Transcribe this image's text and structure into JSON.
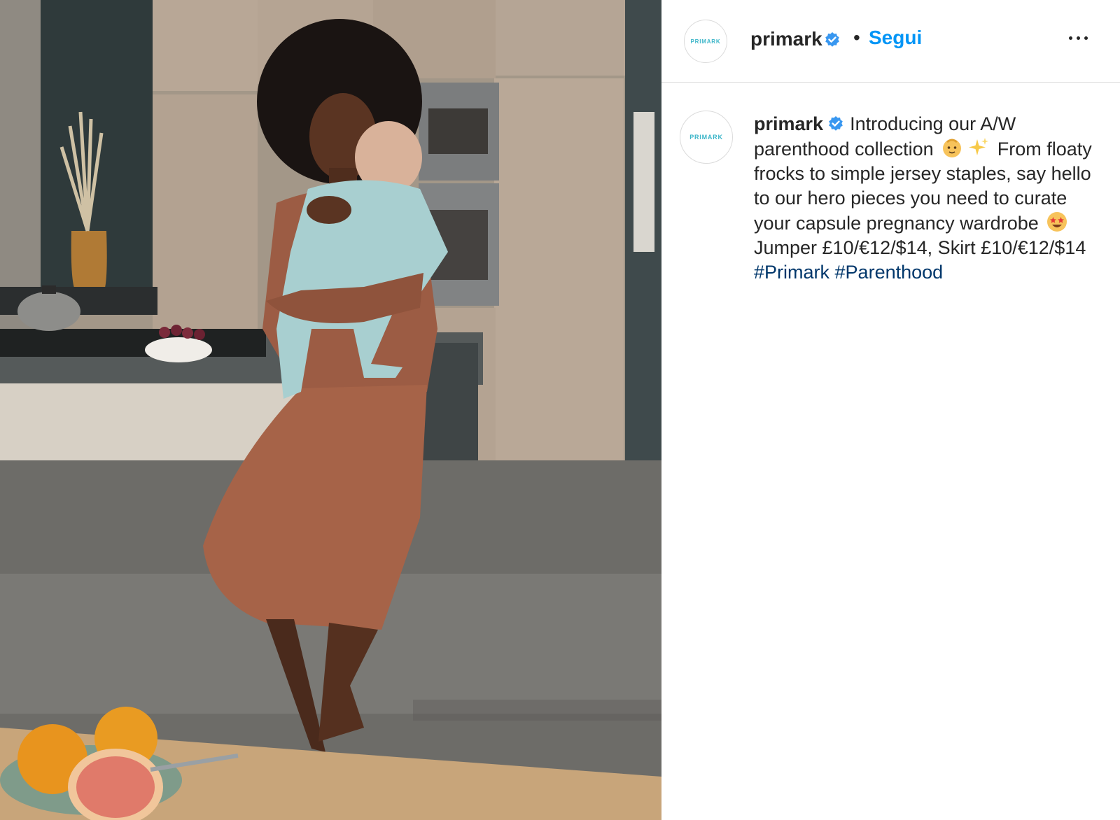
{
  "post": {
    "image": {
      "description_icon": "photo-of-woman-holding-baby-in-kitchen"
    },
    "header": {
      "avatar_text": "PRIMARK",
      "username": "primark",
      "separator": "•",
      "follow_label": "Segui"
    },
    "caption": {
      "avatar_text": "PRIMARK",
      "username": "primark",
      "text_part1": "Introducing our A/W parenthood collection",
      "text_part2": "From floaty frocks to simple jersey staples, say hello to our hero pieces you need to curate your capsule pregnancy wardrobe",
      "text_part3": "Jumper £10/€12/$14, Skirt £10/€12/$14",
      "hashtags": [
        "#Primark",
        "#Parenthood"
      ]
    }
  },
  "colors": {
    "follow": "#0095f6",
    "hashtag": "#00376b",
    "verified": "#3897f0",
    "text": "#262626",
    "divider": "#dbdbdb"
  }
}
